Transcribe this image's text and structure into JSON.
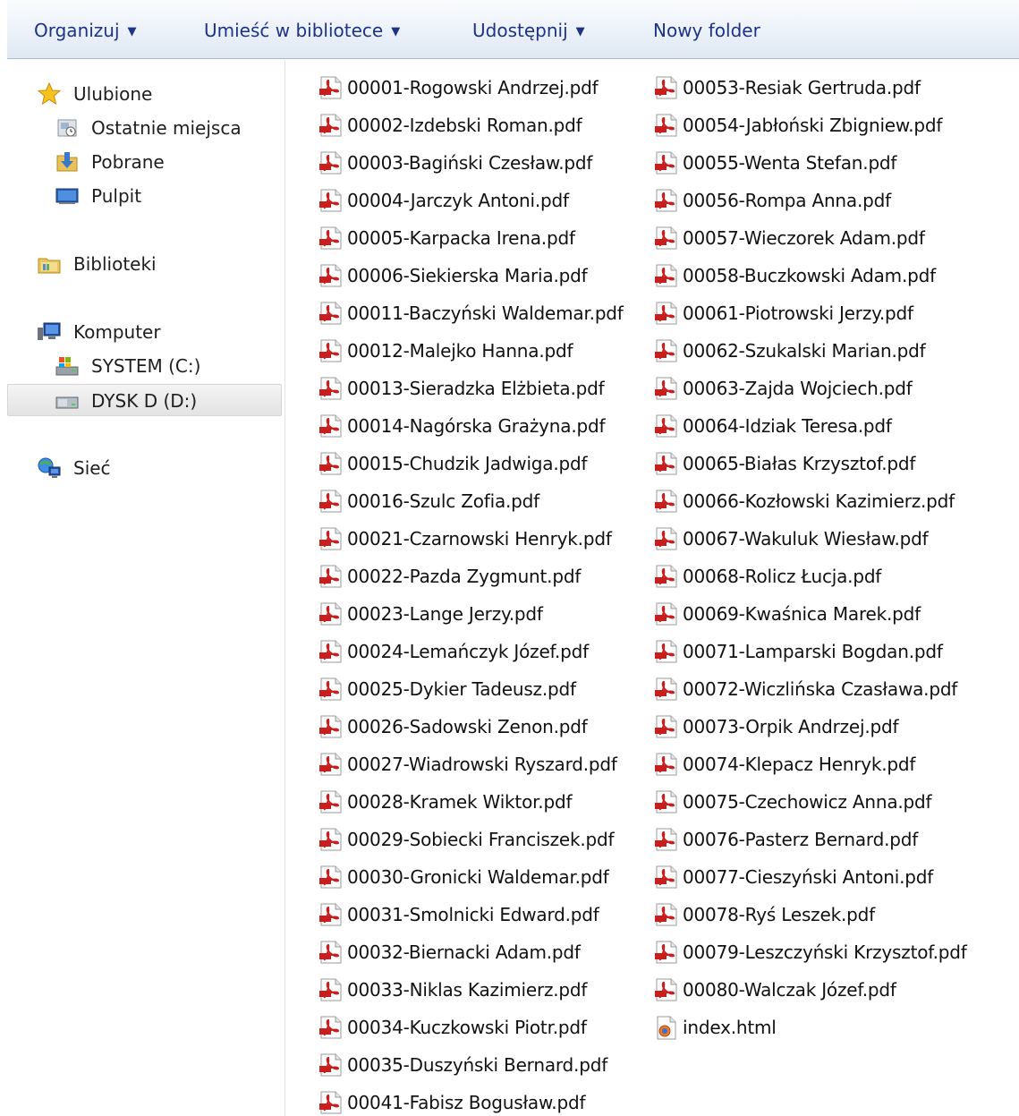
{
  "toolbar": {
    "organize": "Organizuj",
    "library": "Umieść w bibliotece",
    "share": "Udostępnij",
    "new_folder": "Nowy folder"
  },
  "nav": {
    "favorites": "Ulubione",
    "recent": "Ostatnie miejsca",
    "downloads": "Pobrane",
    "desktop": "Pulpit",
    "libraries": "Biblioteki",
    "computer": "Komputer",
    "drive_c": "SYSTEM (C:)",
    "drive_d": "DYSK D (D:)",
    "network": "Sieć"
  },
  "files_col1": [
    "00001-Rogowski Andrzej.pdf",
    "00002-Izdebski Roman.pdf",
    "00003-Bagiński Czesław.pdf",
    "00004-Jarczyk Antoni.pdf",
    "00005-Karpacka Irena.pdf",
    "00006-Siekierska Maria.pdf",
    "00011-Baczyński Waldemar.pdf",
    "00012-Malejko Hanna.pdf",
    "00013-Sieradzka Elżbieta.pdf",
    "00014-Nagórska Grażyna.pdf",
    "00015-Chudzik Jadwiga.pdf",
    "00016-Szulc Zofia.pdf",
    "00021-Czarnowski Henryk.pdf",
    "00022-Pazda Zygmunt.pdf",
    "00023-Lange Jerzy.pdf",
    "00024-Lemańczyk Józef.pdf",
    "00025-Dykier Tadeusz.pdf",
    "00026-Sadowski Zenon.pdf",
    "00027-Wiadrowski Ryszard.pdf",
    "00028-Kramek Wiktor.pdf",
    "00029-Sobiecki Franciszek.pdf",
    "00030-Gronicki Waldemar.pdf",
    "00031-Smolnicki Edward.pdf",
    "00032-Biernacki Adam.pdf",
    "00033-Niklas Kazimierz.pdf",
    "00034-Kuczkowski Piotr.pdf",
    "00035-Duszyński Bernard.pdf",
    "00041-Fabisz Bogusław.pdf"
  ],
  "files_col2": [
    "00053-Resiak Gertruda.pdf",
    "00054-Jabłoński Zbigniew.pdf",
    "00055-Wenta Stefan.pdf",
    "00056-Rompa Anna.pdf",
    "00057-Wieczorek Adam.pdf",
    "00058-Buczkowski Adam.pdf",
    "00061-Piotrowski Jerzy.pdf",
    "00062-Szukalski Marian.pdf",
    "00063-Zajda Wojciech.pdf",
    "00064-Idziak Teresa.pdf",
    "00065-Białas Krzysztof.pdf",
    "00066-Kozłowski Kazimierz.pdf",
    "00067-Wakuluk Wiesław.pdf",
    "00068-Rolicz Łucja.pdf",
    "00069-Kwaśnica Marek.pdf",
    "00071-Lamparski Bogdan.pdf",
    "00072-Wiczlińska Czasława.pdf",
    "00073-Orpik Andrzej.pdf",
    "00074-Klepacz Henryk.pdf",
    "00075-Czechowicz Anna.pdf",
    "00076-Pasterz Bernard.pdf",
    "00077-Cieszyński Antoni.pdf",
    "00078-Ryś Leszek.pdf",
    "00079-Leszczyński Krzysztof.pdf",
    "00080-Walczak Józef.pdf",
    "index.html"
  ],
  "icons": {
    "pdf": "pdf-file-icon",
    "html": "html-file-icon"
  },
  "colors": {
    "toolbar_text": "#1e3287",
    "pdf_red": "#c81e1e"
  }
}
